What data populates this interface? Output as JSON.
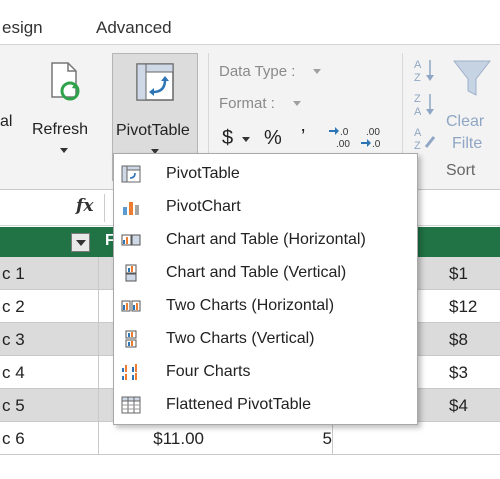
{
  "tabs": [
    {
      "label": "esign"
    },
    {
      "label": "Advanced"
    }
  ],
  "ribbon": {
    "partial_label": "al",
    "refresh_label": "Refresh",
    "pivottable_label": "PivotTable",
    "data_type_label": "Data Type :",
    "format_label": "Format :",
    "currency_symbol": "$",
    "percent_symbol": "%",
    "comma_symbol": "ʼ",
    "increase_decimal": "→.0",
    "decrease_decimal": ".00",
    "clear_label": "Clear",
    "filter_label": "Filte",
    "sort_label": "Sort"
  },
  "formula_bar": {
    "fx": "fx"
  },
  "grid": {
    "header_filter_caret": "▼",
    "header_b": "F",
    "rows": [
      {
        "a": "c 1",
        "b": "",
        "c": "",
        "d": "$1"
      },
      {
        "a": "c 2",
        "b": "",
        "c": "",
        "d": "$12"
      },
      {
        "a": "c 3",
        "b": "",
        "c": "",
        "d": "$8"
      },
      {
        "a": "c 4",
        "b": "",
        "c": "",
        "d": "$3"
      },
      {
        "a": "c 5",
        "b": "",
        "c": "",
        "d": "$4"
      },
      {
        "a": "c 6",
        "b": "$11.00",
        "c": "5",
        "d": ""
      }
    ]
  },
  "menu": {
    "items": [
      {
        "label": "PivotTable",
        "icon": "pivottable-icon"
      },
      {
        "label": "PivotChart",
        "icon": "pivotchart-icon"
      },
      {
        "label": "Chart and Table (Horizontal)",
        "icon": "chart-table-horizontal-icon"
      },
      {
        "label": "Chart and Table (Vertical)",
        "icon": "chart-table-vertical-icon"
      },
      {
        "label": "Two Charts (Horizontal)",
        "icon": "two-charts-horizontal-icon"
      },
      {
        "label": "Two Charts (Vertical)",
        "icon": "two-charts-vertical-icon"
      },
      {
        "label": "Four Charts",
        "icon": "four-charts-icon"
      },
      {
        "label": "Flattened PivotTable",
        "icon": "flattened-pivottable-icon"
      }
    ]
  },
  "colors": {
    "header_green": "#217346",
    "accent_blue": "#2e75b6",
    "ribbon_bg": "#f3f3f3"
  }
}
